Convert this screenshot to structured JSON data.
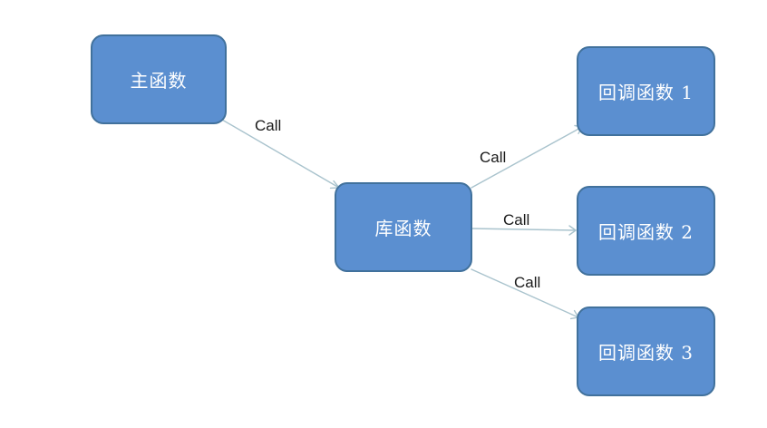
{
  "diagram": {
    "nodes": {
      "main": {
        "label": "主函数"
      },
      "library": {
        "label": "库函数"
      },
      "callback1": {
        "label": "回调函数 1"
      },
      "callback2": {
        "label": "回调函数 2"
      },
      "callback3": {
        "label": "回调函数 3"
      }
    },
    "edges": {
      "main_to_library": {
        "label": "Call"
      },
      "library_to_callback1": {
        "label": "Call"
      },
      "library_to_callback2": {
        "label": "Call"
      },
      "library_to_callback3": {
        "label": "Call"
      }
    },
    "colors": {
      "node_fill": "#5b8fd0",
      "node_border": "#41719c",
      "arrow": "#a9c3cd"
    }
  }
}
